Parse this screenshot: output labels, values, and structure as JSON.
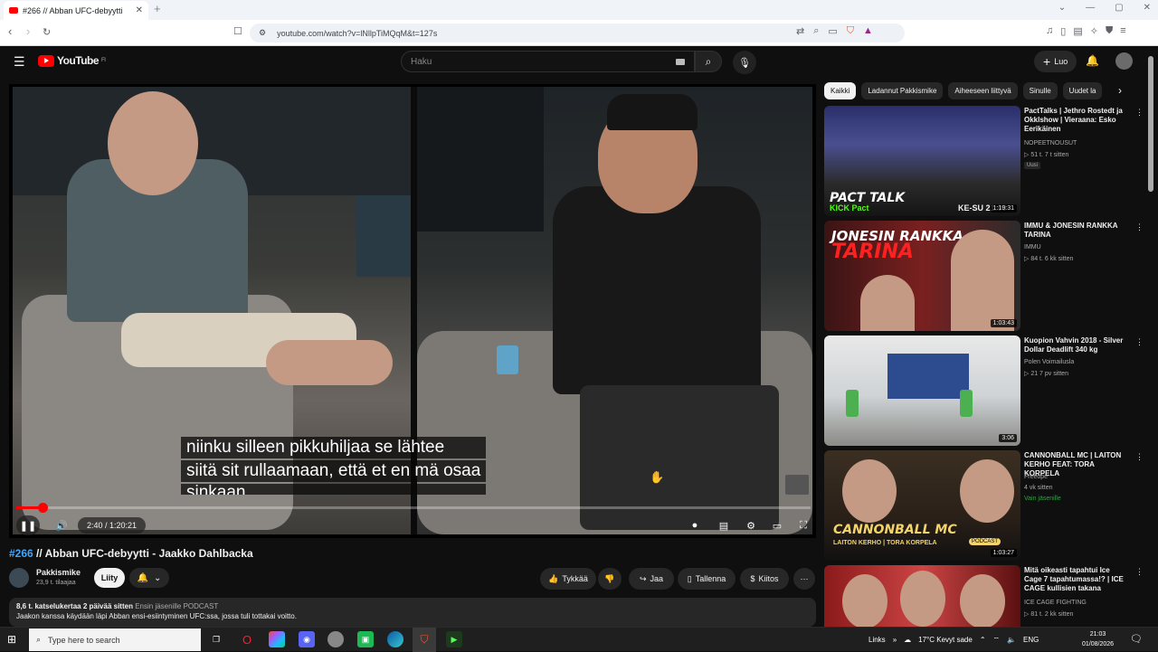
{
  "browser": {
    "tab_title": "#266 // Abban UFC-debyytti",
    "tab_close": "✕",
    "new_tab": "+",
    "url": "youtube.com/watch?v=lNllpTiMQqM&t=127s"
  },
  "yt_header": {
    "logo_text": "YouTube",
    "logo_sup": "FI",
    "search_placeholder": "Haku",
    "create_label": "Luo",
    "create_plus": "+"
  },
  "player": {
    "subtitle_lines": [
      "niinku silleen pikkuhiljaa se lähtee",
      "siitä sit rullaamaan, että et en mä osaa",
      "sinkaan"
    ],
    "time": "2:40 / 1:20:21",
    "progress": 0.033
  },
  "video": {
    "tag": "#266",
    "title": " // Abban UFC-debyytti - Jaakko Dahlbacka",
    "channel": "Pakkismike",
    "subscribers": "23,9 t. tilaajaa",
    "join_label": "Liity",
    "like_label": "Tykkää",
    "share_label": "Jaa",
    "save_label": "Tallenna",
    "thanks_label": "Kiitos",
    "more_label": "⋯"
  },
  "description": {
    "meta": "8,6 t. katselukertaa  2 päivää sitten",
    "meta_extra": "Ensin jäsenille  PODCAST",
    "text": "Jaakon kanssa käydään läpi Abban ensi-esiintyminen UFC:ssa, jossa tuli tottakai voitto."
  },
  "chips": [
    "Kaikki",
    "Ladannut Pakkismike",
    "Aiheeseen liittyvä",
    "Sinulle",
    "Uudet la"
  ],
  "recommendations": [
    {
      "title": "PactTalks | Jethro Rostedt ja Okklshow | Vieraana: Esko Eerikäinen",
      "channel": "NOPEETNOUSUT",
      "meta": "▷ 51 t.  7 t sitten",
      "badge": "Uusi",
      "duration": "1:19:31",
      "thumb_text": "PACT TALK",
      "thumb_sub": "KICK  Pact",
      "thumb_sub2": "KE-SU 21:00"
    },
    {
      "title": "IMMU & JONESIN RANKKA TARINA",
      "channel": "IMMU",
      "meta": "▷ 84 t.  6 kk sitten",
      "duration": "1:03:43",
      "thumb_text": "JONESIN RANKKA",
      "thumb_sub": "TARINA"
    },
    {
      "title": "Kuopion Vahvin 2018 - Silver Dollar Deadlift 340 kg",
      "channel": "Polen Voimailusla",
      "meta": "▷ 21  7 pv sitten",
      "duration": "3:06"
    },
    {
      "title": "CANNONBALL MC | LAITON KERHO FEAT: TORA KORPELA",
      "channel": "Freeope",
      "meta": "4 vk sitten",
      "member": "Vain jäsenille",
      "duration": "1:03:27",
      "thumb_text": "CANNONBALL MC",
      "thumb_sub": "LAITON KERHO | TORA KORPELA",
      "thumb_badge": "PODCAST"
    },
    {
      "title": "Mitä oikeasti tapahtui Ice Cage 7 tapahtumassa!? | ICE CAGE kullisien takana",
      "channel": "ICE CAGE FIGHTING",
      "meta": "▷ 81 t.  2 kk sitten"
    }
  ],
  "taskbar": {
    "search_placeholder": "Type here to search",
    "links": "Links",
    "weather": "17°C  Kevyt sade",
    "lang": "ENG",
    "time": "21:03",
    "date": "01/08/2026"
  },
  "colors": {
    "bg": "#0f0f0f",
    "accent": "#ff0000",
    "link": "#3ea6ff"
  }
}
